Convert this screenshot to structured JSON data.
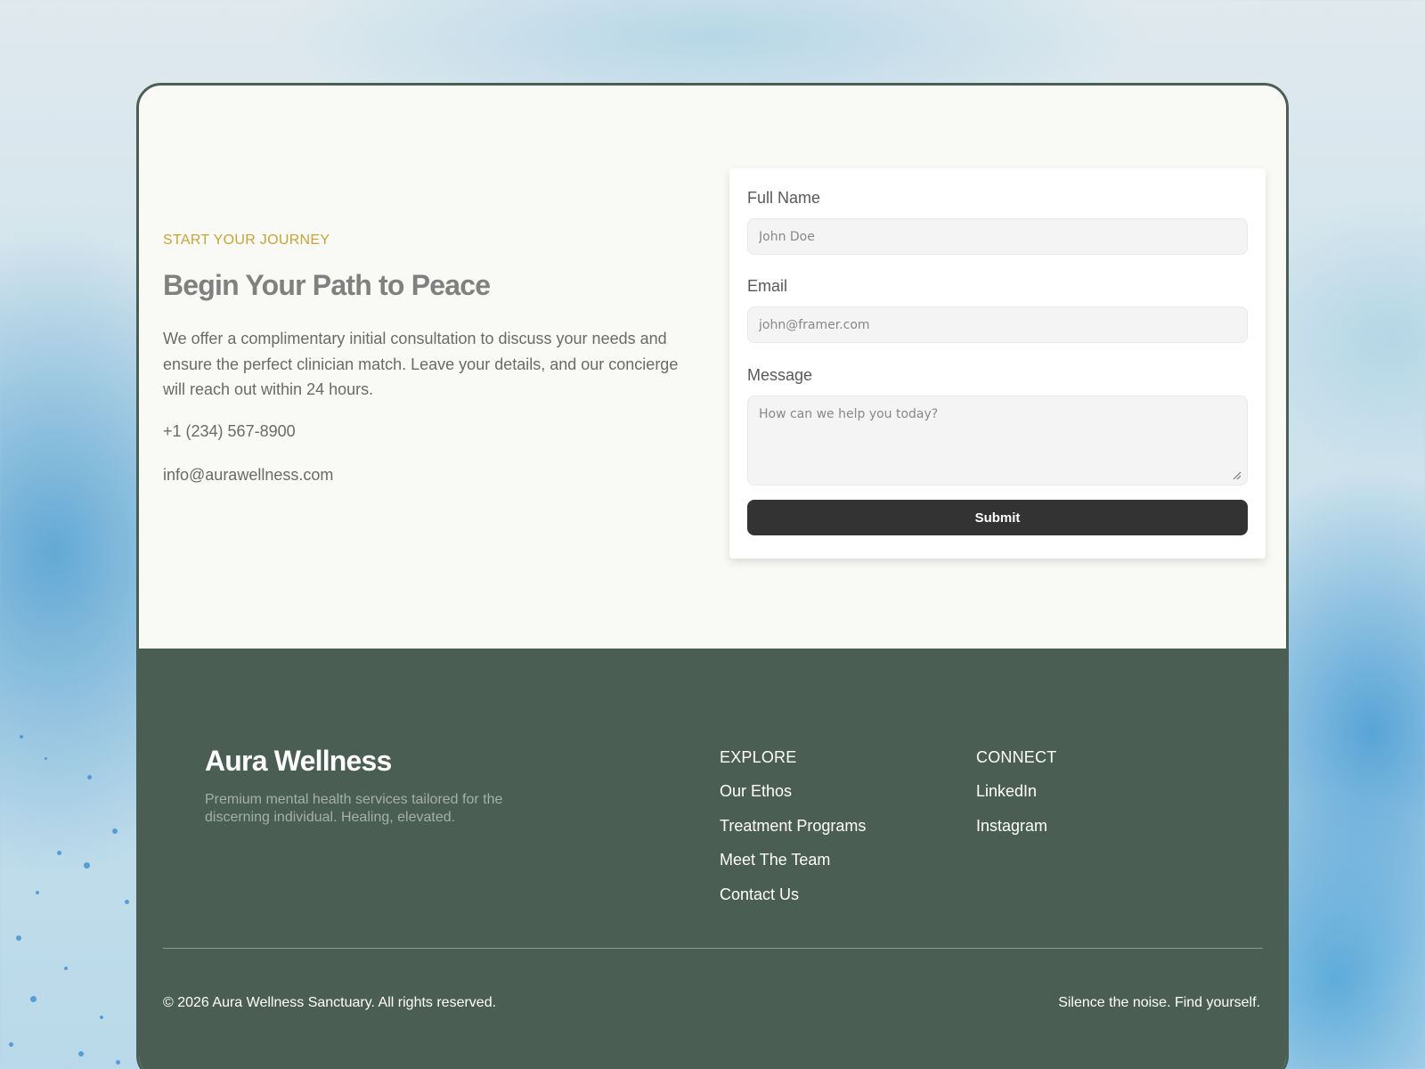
{
  "contact": {
    "eyebrow": "START YOUR JOURNEY",
    "headline": "Begin Your Path to Peace",
    "intro": "We offer a complimentary initial consultation to discuss your needs and ensure the perfect clinician match. Leave your details, and our concierge will reach out within 24 hours.",
    "phone": "+1 (234) 567-8900",
    "email": "info@aurawellness.com"
  },
  "form": {
    "name_label": "Full Name",
    "name_placeholder": "John Doe",
    "name_value": "",
    "email_label": "Email",
    "email_placeholder": "john@framer.com",
    "email_value": "",
    "message_label": "Message",
    "message_placeholder": "How can we help you today?",
    "message_value": "",
    "submit_label": "Submit"
  },
  "footer": {
    "brand": "Aura Wellness",
    "tagline": "Premium mental health services tailored for the discerning individual. Healing, elevated.",
    "explore": {
      "title": "EXPLORE",
      "links": [
        "Our Ethos",
        "Treatment Programs",
        "Meet The Team",
        "Contact Us"
      ]
    },
    "connect": {
      "title": "CONNECT",
      "links": [
        "LinkedIn",
        "Instagram"
      ]
    },
    "copyright": "© 2026 Aura Wellness Sanctuary. All rights reserved.",
    "motto": "Silence the noise. Find yourself."
  },
  "colors": {
    "accent_gold": "#c7a43a",
    "footer_green": "#4b5e53",
    "button_dark": "#333333",
    "card_background": "#f9f9f5"
  }
}
